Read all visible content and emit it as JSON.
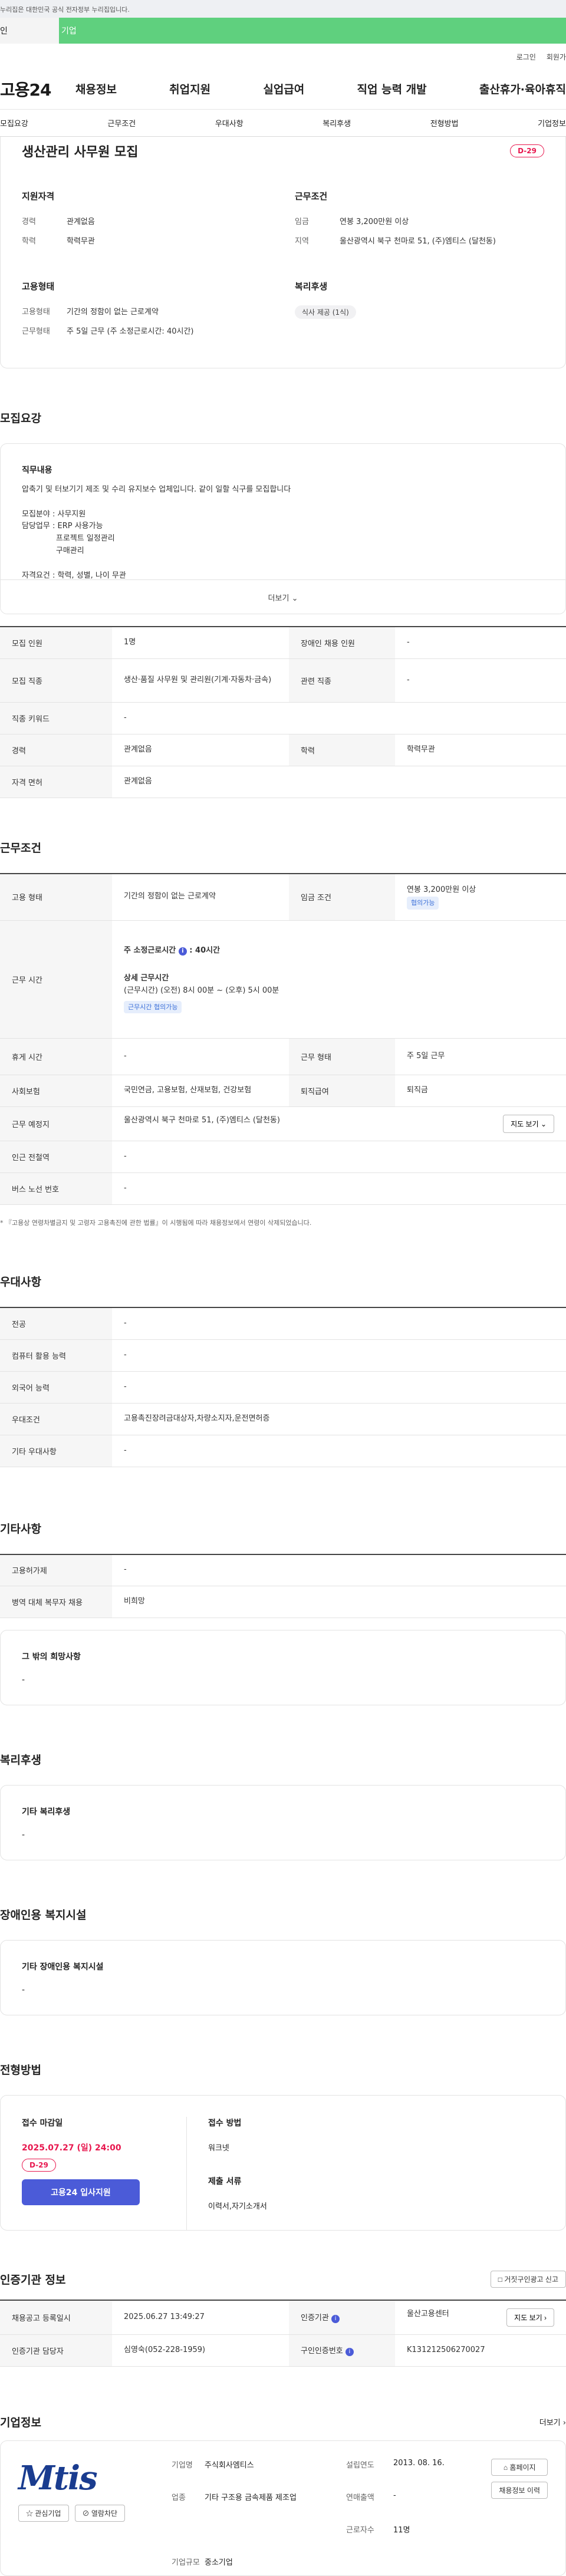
{
  "gov_banner": "누리집은 대한민국 공식 전자정부 누리집입니다.",
  "user_tabs": [
    "인",
    "기업"
  ],
  "util_links": [
    "로그인",
    "회원가"
  ],
  "site_logo": "고용24",
  "gnb": [
    "채용정보",
    "취업지원",
    "실업급여",
    "직업 능력 개발",
    "출산휴가·육아휴직"
  ],
  "anchor_nav": [
    "모집요강",
    "근무조건",
    "우대사항",
    "복리후생",
    "전형방법",
    "기업정보"
  ],
  "summary": {
    "title": "생산관리 사무원 모집",
    "dday": "D-29",
    "qual_title": "지원자격",
    "qual": [
      {
        "k": "경력",
        "v": "관계없음"
      },
      {
        "k": "학력",
        "v": "학력무관"
      }
    ],
    "cond_title": "근무조건",
    "cond": [
      {
        "k": "임금",
        "v": "연봉 3,200만원 이상"
      },
      {
        "k": "지역",
        "v": "울산광역시 북구 천마로 51, (주)엠티스 (달천동)"
      }
    ],
    "emp_title": "고용형태",
    "emp": [
      {
        "k": "고용형태",
        "v": "기간의 정함이 없는 근로계약"
      },
      {
        "k": "근무형태",
        "v": "주 5일 근무 (주 소정근로시간: 40시간)"
      }
    ],
    "welfare_title": "복리후생",
    "welfare_chip": "식사 제공 (1식)"
  },
  "recruit": {
    "title": "모집요강",
    "card_title": "직무내용",
    "text": "압축기 및 터보기기 제조 및 수리 유지보수 업체입니다. 같이 일할 식구를 모집합니다\n\n모집분야 : 사무지원\n담당업무 : ERP 사용가능\n              프로젝트 일정관리\n              구매관리\n\n자격요건 : 학력, 성별, 나이 무관\n우대사항 : 컴퓨터 활용 능숙자",
    "more": "더보기",
    "rows": [
      {
        "k1": "모집 인원",
        "v1": "1명",
        "k2": "장애인 채용 인원",
        "v2": "-"
      },
      {
        "k1": "모집 직종",
        "v1": "생산·품질 사무원 및 관리원(기계·자동차·금속)",
        "k2": "관련 직종",
        "v2": "-"
      },
      {
        "k1": "직종 키워드",
        "v1": "-"
      },
      {
        "k1": "경력",
        "v1": "관계없음",
        "k2": "학력",
        "v2": "학력무관"
      },
      {
        "k1": "자격 면허",
        "v1": "관계없음"
      }
    ]
  },
  "work": {
    "title": "근무조건",
    "emp_type_k": "고용 형태",
    "emp_type_v": "기간의 정함이 없는 근로계약",
    "wage_k": "임금 조건",
    "wage_v": "연봉 3,200만원 이상",
    "wage_tag": "협의가능",
    "hours_k": "근무 시간",
    "hours_main": "주 소정근로시간",
    "hours_value": "40시간",
    "hours_detail_title": "상세 근무시간",
    "hours_detail": "(근무시간) (오전) 8시 00분 ~ (오후) 5시 00분",
    "hours_tag": "근무시간 협의가능",
    "rest_k": "휴게 시간",
    "rest_v": "-",
    "work_form_k": "근무 형태",
    "work_form_v": "주 5일 근무",
    "insurance_k": "사회보험",
    "insurance_v": "국민연금, 고용보험, 산재보험, 건강보험",
    "retire_k": "퇴직급여",
    "retire_v": "퇴직금",
    "place_k": "근무 예정지",
    "place_v": "울산광역시 북구 천마로 51, (주)엠티스 (달천동)",
    "map_btn": "지도 보기",
    "subway_k": "인근 전철역",
    "subway_v": "-",
    "bus_k": "버스 노선 번호",
    "bus_v": "-",
    "note": "* 『고용상 연령차별금지 및 고령자 고용촉진에 관한 법률』이 시행됨에 따라 채용정보에서 연령이 삭제되었습니다."
  },
  "pref": {
    "title": "우대사항",
    "rows": [
      {
        "k": "전공",
        "v": "-"
      },
      {
        "k": "컴퓨터 활용 능력",
        "v": "-"
      },
      {
        "k": "외국어 능력",
        "v": "-"
      },
      {
        "k": "우대조건",
        "v": "고용촉진장려금대상자,차량소지자,운전면허증"
      },
      {
        "k": "기타 우대사항",
        "v": "-"
      }
    ]
  },
  "etc": {
    "title": "기타사항",
    "rows": [
      {
        "k": "고용허가제",
        "v": "-"
      },
      {
        "k": "병역 대체 복무자 채용",
        "v": "비희망"
      }
    ],
    "card_title": "그 밖의 희망사항",
    "card_value": "-"
  },
  "welfare": {
    "title": "복리후생",
    "card_title": "기타 복리후생",
    "card_value": "-"
  },
  "disability": {
    "title": "장애인용 복지시설",
    "card_title": "기타 장애인용 복지시설",
    "card_value": "-"
  },
  "process": {
    "title": "전형방법",
    "deadline_title": "접수 마감일",
    "deadline": "2025.07.27 (일) 24:00",
    "dday": "D-29",
    "apply_btn": "고용24 입사지원",
    "method_title": "접수 방법",
    "method": "워크넷",
    "docs_title": "제출 서류",
    "docs": "이력서,자기소개서"
  },
  "cert": {
    "title": "인증기관 정보",
    "report_btn": "거짓구인광고 신고",
    "reg_date_k": "채용공고 등록일시",
    "reg_date_v": "2025.06.27 13:49:27",
    "agency_k": "인증기관",
    "agency_v": "울산고용센터",
    "map_btn": "지도 보기",
    "manager_k": "인증기관 담당자",
    "manager_v": "심영숙(052-228-1959)",
    "job_no_k": "구인인증번호",
    "job_no_v": "K131212506270027"
  },
  "company": {
    "title": "기업정보",
    "more": "더보기",
    "logo_text": "Mtis",
    "interest_btn": "관심기업",
    "block_btn": "열람차단",
    "name_k": "기업명",
    "name_v": "주식회사엠티스",
    "founded_k": "설립연도",
    "founded_v": "2013. 08. 16.",
    "industry_k": "업종",
    "industry_v": "기타 구조용 금속제품 제조업",
    "sales_k": "연매출액",
    "sales_v": "-",
    "employees_k": "근로자수",
    "employees_v": "11명",
    "size_k": "기업규모",
    "size_v": "중소기업",
    "homepage_btn": "홈페이지",
    "jobs_btn": "채용정보 이력"
  }
}
